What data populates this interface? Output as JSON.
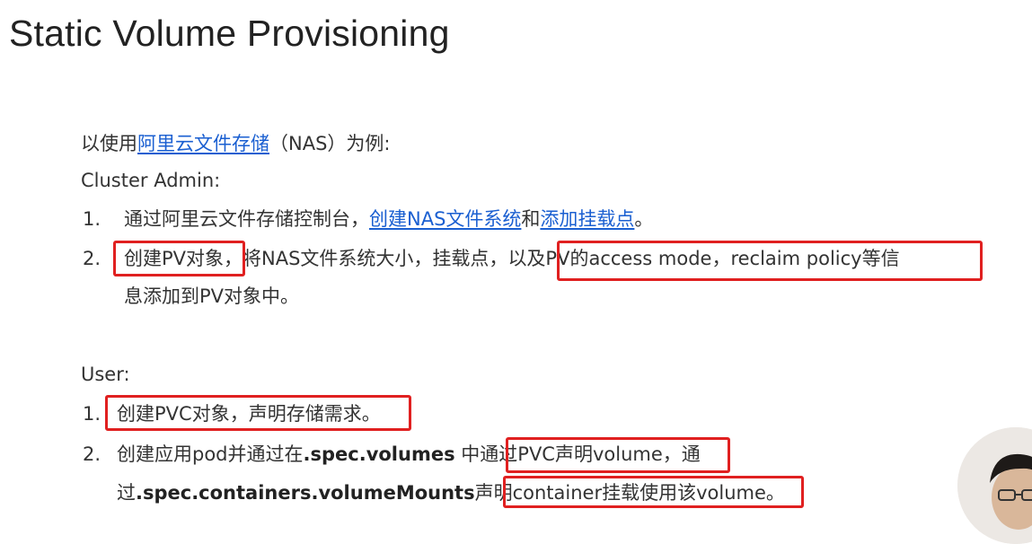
{
  "title": "Static Volume Provisioning",
  "intro": {
    "prefix": "以使用",
    "link": "阿里云文件存储",
    "suffix": "（NAS）为例:"
  },
  "admin": {
    "heading": "Cluster Admin:",
    "items": [
      {
        "num": "1.",
        "text": "通过阿里云文件存储控制台，",
        "link1": "创建NAS文件系统",
        "mid": "和",
        "link2": "添加挂载点",
        "end": "。"
      },
      {
        "num": "2.",
        "boxed1": "创建PV对象",
        "text": "，将NAS文件系统大小，挂载点，",
        "boxed2": "以及PV的access mode，reclaim policy",
        "end": "等信",
        "cont": "息添加到PV对象中。"
      }
    ]
  },
  "user": {
    "heading": "User:",
    "items": [
      {
        "num": "1.",
        "boxed": "创建PVC对象，声明存储需求",
        "end": "。"
      },
      {
        "num": "2.",
        "text1": "创建应用pod并通过在",
        "code1": ".spec.volumes",
        "text2": " 中",
        "boxed1": "通过PVC声明volume",
        "end1": "，通",
        "cont_prefix": "过",
        "code2": ".spec.containers.volumeMounts",
        "cont_mid": "声明",
        "boxed2": "container挂载使用该volume",
        "end2": "。"
      }
    ]
  },
  "colors": {
    "link": "#1a5fd1",
    "highlight_box": "#e02020",
    "text": "#333333"
  }
}
